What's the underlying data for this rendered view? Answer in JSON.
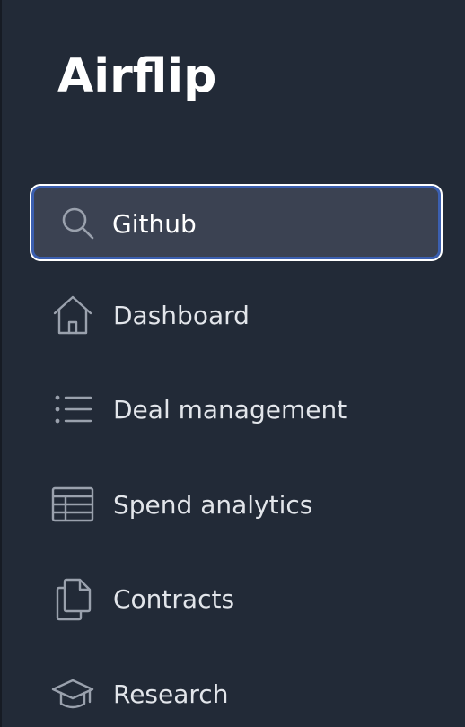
{
  "app": {
    "logo_text": "Airflip"
  },
  "search": {
    "value": "Github",
    "icon": "search-icon"
  },
  "nav": {
    "items": [
      {
        "label": "Dashboard",
        "icon": "home-icon"
      },
      {
        "label": "Deal management",
        "icon": "list-icon"
      },
      {
        "label": "Spend analytics",
        "icon": "table-icon"
      },
      {
        "label": "Contracts",
        "icon": "documents-icon"
      },
      {
        "label": "Research",
        "icon": "graduation-cap-icon"
      }
    ]
  },
  "colors": {
    "background": "#222a37",
    "search_bg": "#3b4252",
    "focus_ring": "#3b5fb0",
    "text": "#e2e5ea",
    "icon": "#9aa1ad"
  }
}
